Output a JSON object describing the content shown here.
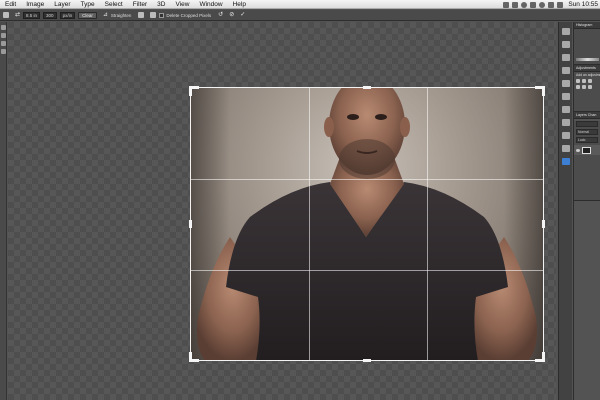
{
  "menubar": {
    "items": [
      "Edit",
      "Image",
      "Layer",
      "Type",
      "Select",
      "Filter",
      "3D",
      "View",
      "Window",
      "Help"
    ],
    "clock": "Sun 10:55"
  },
  "options": {
    "width_value": "8.5 in",
    "resolution_value": "300",
    "resolution_unit": "px/in",
    "clear_label": "Clear",
    "straighten_label": "Straighten",
    "delete_cropped_label": "Delete Cropped Pixels"
  },
  "panels": {
    "histogram_tab": "Histogram",
    "adjustments_tab": "Adjustments",
    "add_adjustment_label": "Add an adjustment",
    "layers_tab": "Layers",
    "channels_tab": "Chan",
    "blend_mode": "Normal",
    "lock_label": "Lock:"
  },
  "colors": {
    "ui_dark": "#4a4a4a",
    "accent": "#3d7fd3",
    "crop_border": "#f3f3f3"
  }
}
